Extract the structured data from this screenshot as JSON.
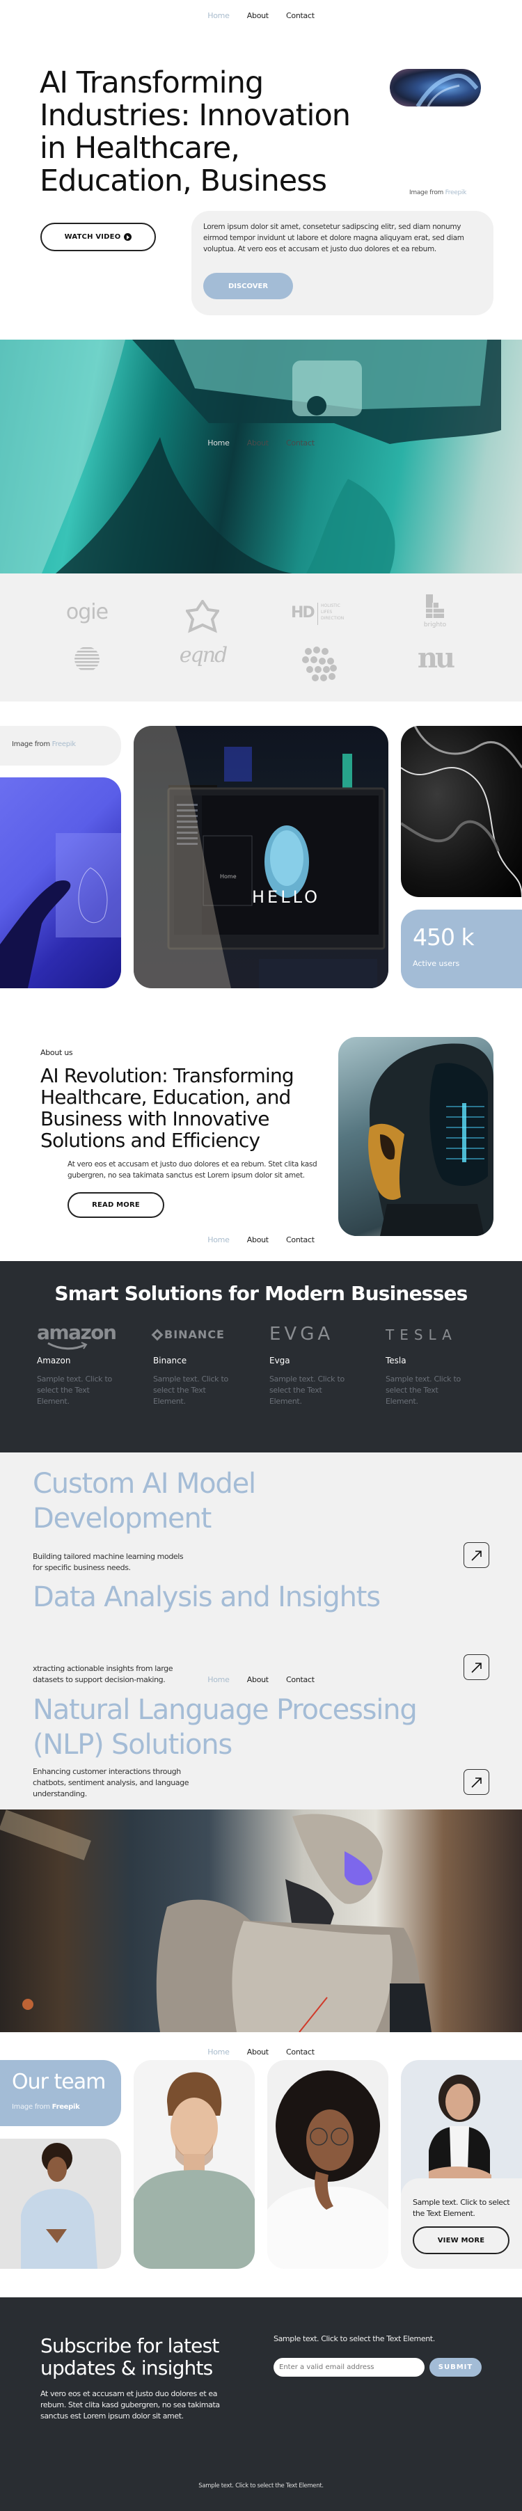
{
  "nav": {
    "items": [
      "Home",
      "About",
      "Contact"
    ],
    "active": "Home"
  },
  "hero": {
    "title_lines": [
      "AI Transforming",
      "Industries: Innovation",
      "in Healthcare,",
      "Education, Business"
    ],
    "watch_video_label": "WATCH VIDEO",
    "image_credit_prefix": "Image from",
    "image_credit_link": "Freepik",
    "card_text": "Lorem ipsum dolor sit amet, consetetur sadipscing elitr, sed diam nonumy eirmod tempor invidunt ut labore et dolore magna aliquyam erat, sed diam voluptua. At vero eos et accusam et justo duo dolores et ea rebum.",
    "discover_label": "DISCOVER"
  },
  "logos": [
    "ogie",
    "star-flower",
    "HD Holistic Lifes Direction",
    "brighto",
    "striped-circle",
    "eqnd",
    "dots-wave",
    "nu"
  ],
  "logo_hd_sub": [
    "HOLISTIC",
    "LIFES",
    "DIRECTION"
  ],
  "gallery": {
    "credit_prefix": "Image from",
    "credit_link": "Freepik",
    "hello_text": "HELLO",
    "stat_value": "450 k",
    "stat_label": "Active users"
  },
  "about": {
    "eyebrow": "About us",
    "title": "AI Revolution: Transforming Healthcare, Education, and Business with Innovative Solutions and Efficiency",
    "text": "At vero eos et accusam et justo duo dolores et ea rebum. Stet clita kasd gubergren, no sea takimata sanctus est Lorem ipsum dolor sit amet.",
    "read_more_label": "READ MORE"
  },
  "solutions": {
    "title": "Smart Solutions for Modern Businesses",
    "brands": [
      {
        "logo": "amazon",
        "name": "Amazon",
        "desc": "Sample text. Click to select the Text Element."
      },
      {
        "logo": "BINANCE",
        "name": "Binance",
        "desc": "Sample text. Click to select the Text Element."
      },
      {
        "logo": "EVGA",
        "name": "Evga",
        "desc": "Sample text. Click to select the Text Element."
      },
      {
        "logo": "TESLA",
        "name": "Tesla",
        "desc": "Sample text. Click to select the Text Element."
      }
    ]
  },
  "services": [
    {
      "title": "Custom AI Model Development",
      "desc": "Building tailored machine learning models for specific business needs."
    },
    {
      "title": "Data Analysis and Insights",
      "desc": "xtracting actionable insights from large datasets to support decision-making."
    },
    {
      "title": "Natural Language Processing (NLP) Solutions",
      "desc": "Enhancing customer interactions through chatbots, sentiment analysis, and language understanding."
    }
  ],
  "team": {
    "title": "Our team",
    "credit_prefix": "Image from",
    "credit_link": "Freepik",
    "card_text": "Sample text. Click to select the Text Element.",
    "view_more_label": "VIEW MORE"
  },
  "subscribe": {
    "title": "Subscribe for latest updates & insights",
    "text": "At vero eos et accusam et justo duo dolores et ea rebum. Stet clita kasd gubergren, no sea takimata sanctus est Lorem ipsum dolor sit amet.",
    "side_text": "Sample text. Click to select the Text Element.",
    "email_placeholder": "Enter a valid email address",
    "submit_label": "SUBMIT"
  },
  "footer": {
    "text": "Sample text. Click to select the Text Element."
  },
  "colors": {
    "accent": "#a3bcd6",
    "dark": "#292d32",
    "light_gray": "#f1f1f1"
  }
}
